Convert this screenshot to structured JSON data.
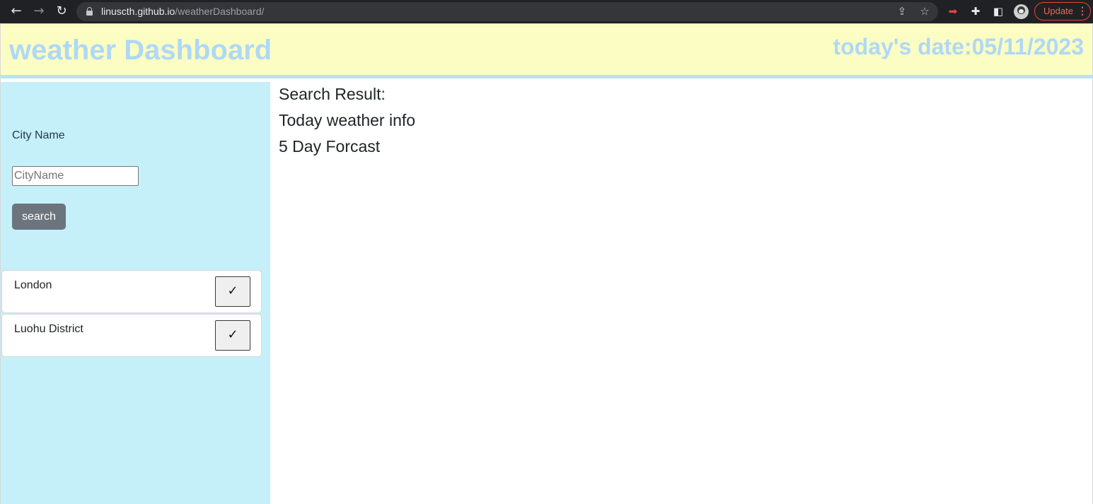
{
  "browser": {
    "url_host": "linuscth.github.io",
    "url_path": "/weatherDashboard/",
    "update_label": "Update"
  },
  "header": {
    "title": "weather Dashboard",
    "date_text": "today's date:05/11/2023"
  },
  "sidebar": {
    "city_label": "City Name",
    "input_placeholder": "CityName",
    "input_value": "",
    "search_label": "search",
    "history": [
      {
        "name": "London",
        "button": "✓"
      },
      {
        "name": "Luohu District",
        "button": "✓"
      }
    ]
  },
  "main": {
    "search_result": "Search Result:",
    "today_info": "Today weather info",
    "forecast": "5 Day Forcast"
  },
  "colors": {
    "header_bg": "#fcfdc2",
    "title_color": "#aed8f6",
    "sidebar_bg": "#c5f0f9",
    "button_bg": "#6c757d"
  }
}
